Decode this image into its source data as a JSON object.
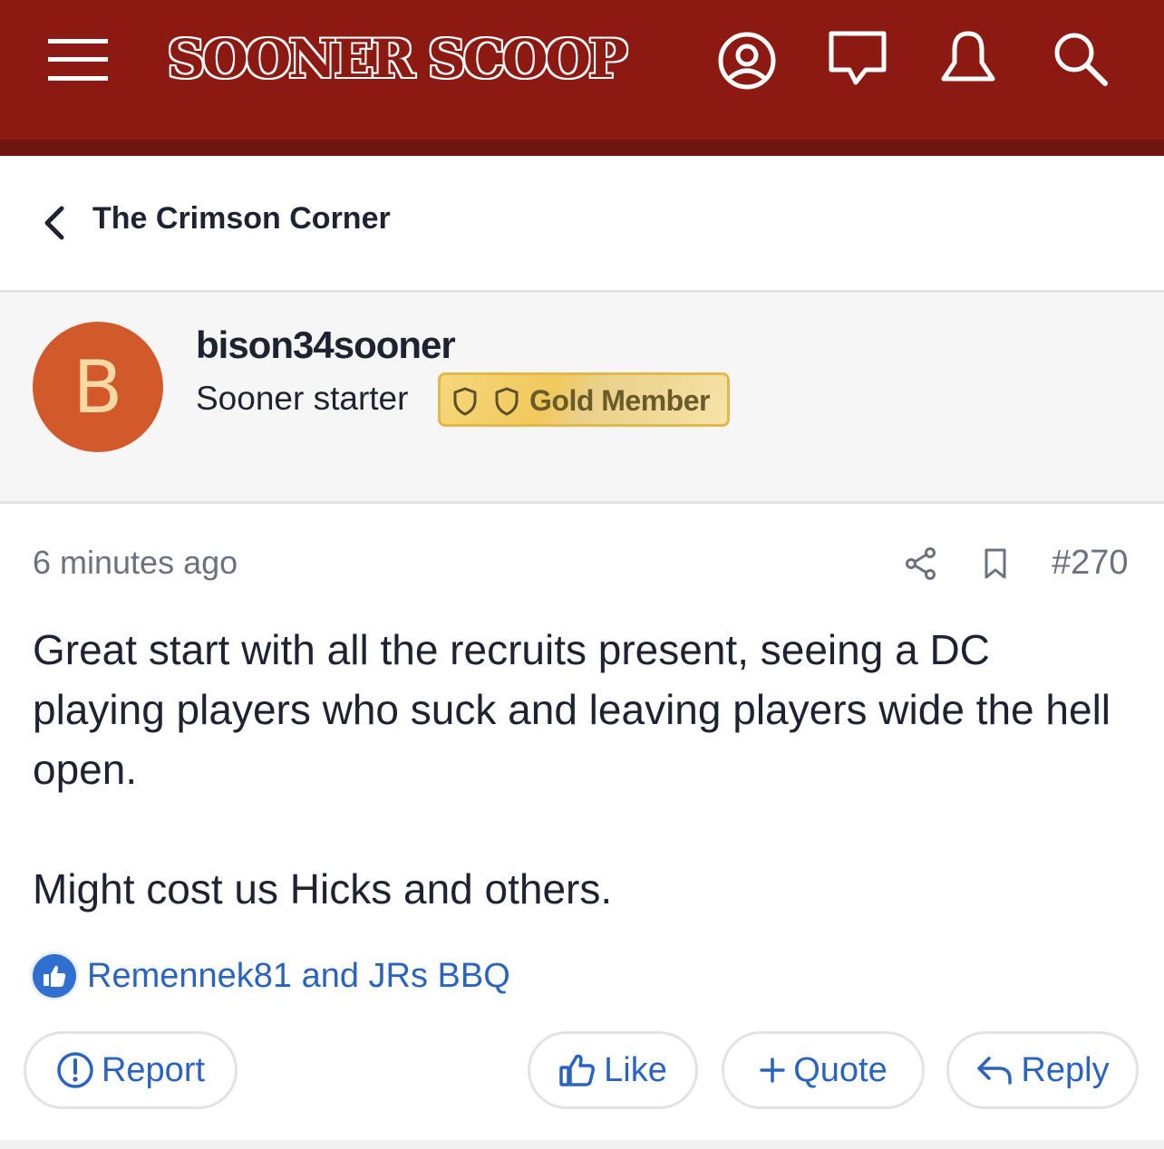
{
  "header": {
    "logo_text": "SOONER SCOOP",
    "colors": {
      "bar": "#8c1a12"
    },
    "icons": [
      "menu-icon",
      "profile-icon",
      "chat-icon",
      "bell-icon",
      "search-icon"
    ]
  },
  "breadcrumb": {
    "label": "The Crimson Corner"
  },
  "author": {
    "avatar_initial": "B",
    "avatar_color": "#d2592a",
    "username": "bison34sooner",
    "title": "Sooner starter",
    "badge": "Gold Member"
  },
  "post": {
    "time": "6 minutes ago",
    "number": "#270",
    "paragraphs": [
      "Great start with all the recruits present, seeing a DC playing players who suck and leaving players wide the hell open.",
      "Might cost us Hicks and others."
    ]
  },
  "reactions": {
    "likes_text": "Remennek81 and JRs BBQ"
  },
  "actions": {
    "report": "Report",
    "like": "Like",
    "quote": "Quote",
    "reply": "Reply"
  },
  "accent_color": "#2a63c1"
}
